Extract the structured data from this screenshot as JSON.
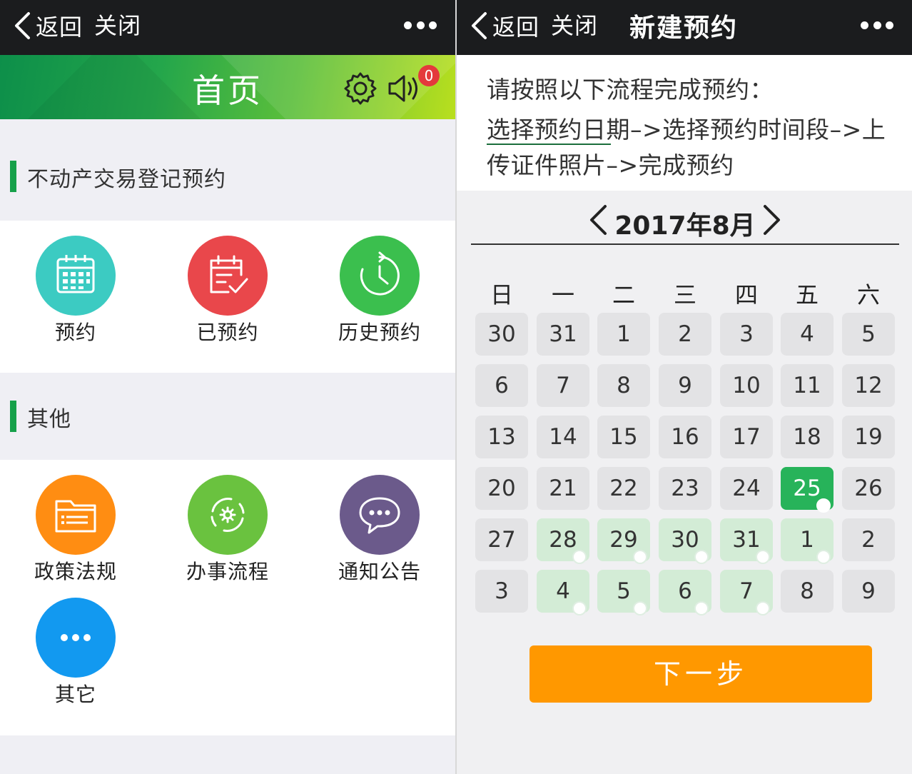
{
  "left": {
    "navbar": {
      "back_label": "返回",
      "close_label": "关闭"
    },
    "hero": {
      "title": "首页",
      "badge": "0"
    },
    "sections": [
      {
        "title": "不动产交易登记预约",
        "items": [
          {
            "label": "预约",
            "icon": "calendar-icon",
            "color": "#3ccbc2"
          },
          {
            "label": "已预约",
            "icon": "calendar-check-icon",
            "color": "#e9474b"
          },
          {
            "label": "历史预约",
            "icon": "history-clock-icon",
            "color": "#3bbf4e"
          }
        ]
      },
      {
        "title": "其他",
        "items": [
          {
            "label": "政策法规",
            "icon": "folder-list-icon",
            "color": "#ff8d12"
          },
          {
            "label": "办事流程",
            "icon": "process-gear-icon",
            "color": "#6ac23f"
          },
          {
            "label": "通知公告",
            "icon": "chat-bubble-icon",
            "color": "#6b5a8b"
          },
          {
            "label": "其它",
            "icon": "more-dots-icon",
            "color": "#1299f0"
          }
        ]
      }
    ]
  },
  "right": {
    "navbar": {
      "back_label": "返回",
      "close_label": "关闭",
      "title": "新建预约"
    },
    "intro": {
      "line1": "请按照以下流程完成预约：",
      "line2": "选择预约日期–>选择预约时间段–>上",
      "line3": "传证件照片–>完成预约"
    },
    "calendar": {
      "month_label": "2017年8月",
      "weekdays": [
        "日",
        "一",
        "二",
        "三",
        "四",
        "五",
        "六"
      ],
      "weeks": [
        [
          "30",
          "31",
          "1",
          "2",
          "3",
          "4",
          "5"
        ],
        [
          "6",
          "7",
          "8",
          "9",
          "10",
          "11",
          "12"
        ],
        [
          "13",
          "14",
          "15",
          "16",
          "17",
          "18",
          "19"
        ],
        [
          "20",
          "21",
          "22",
          "23",
          "24",
          "25",
          "26"
        ],
        [
          "27",
          "28",
          "29",
          "30",
          "31",
          "1",
          "2"
        ],
        [
          "3",
          "4",
          "5",
          "6",
          "7",
          "8",
          "9"
        ]
      ],
      "selected": "25",
      "available": [
        "28",
        "29",
        "30",
        "31",
        "1",
        "4",
        "5",
        "6",
        "7"
      ]
    },
    "next_button": "下一步"
  },
  "colors": {
    "header_bg": "#1b1c1e",
    "accent_green": "#16a04a",
    "selected_day": "#27b35a",
    "available_day": "#d3ecd6",
    "button_orange": "#ff9800",
    "badge_red": "#e4393c"
  }
}
